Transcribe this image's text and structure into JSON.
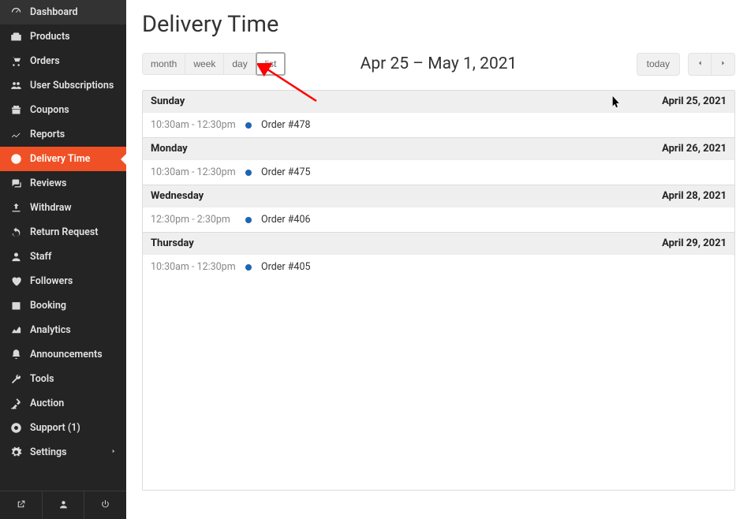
{
  "sidebar": {
    "items": [
      {
        "label": "Dashboard",
        "icon": "dashboard"
      },
      {
        "label": "Products",
        "icon": "briefcase"
      },
      {
        "label": "Orders",
        "icon": "cart"
      },
      {
        "label": "User Subscriptions",
        "icon": "users"
      },
      {
        "label": "Coupons",
        "icon": "gift"
      },
      {
        "label": "Reports",
        "icon": "chart"
      },
      {
        "label": "Delivery Time",
        "icon": "clock",
        "active": true
      },
      {
        "label": "Reviews",
        "icon": "comments"
      },
      {
        "label": "Withdraw",
        "icon": "upload"
      },
      {
        "label": "Return Request",
        "icon": "undo"
      },
      {
        "label": "Staff",
        "icon": "user"
      },
      {
        "label": "Followers",
        "icon": "heart"
      },
      {
        "label": "Booking",
        "icon": "calendar"
      },
      {
        "label": "Analytics",
        "icon": "area"
      },
      {
        "label": "Announcements",
        "icon": "bell"
      },
      {
        "label": "Tools",
        "icon": "wrench"
      },
      {
        "label": "Auction",
        "icon": "gavel"
      },
      {
        "label": "Support (1)",
        "icon": "life-ring"
      },
      {
        "label": "Settings",
        "icon": "cog",
        "expandable": true
      }
    ]
  },
  "pageTitle": "Delivery Time",
  "toolbar": {
    "viewButtons": [
      {
        "label": "month",
        "active": false
      },
      {
        "label": "week",
        "active": false
      },
      {
        "label": "day",
        "active": false
      },
      {
        "label": "list",
        "active": true
      }
    ],
    "dateRange": "Apr 25 – May 1, 2021",
    "today": "today"
  },
  "calendar": {
    "days": [
      {
        "name": "Sunday",
        "date": "April 25, 2021",
        "events": [
          {
            "time": "10:30am - 12:30pm",
            "title": "Order #478"
          }
        ]
      },
      {
        "name": "Monday",
        "date": "April 26, 2021",
        "events": [
          {
            "time": "10:30am - 12:30pm",
            "title": "Order #475"
          }
        ]
      },
      {
        "name": "Wednesday",
        "date": "April 28, 2021",
        "events": [
          {
            "time": "12:30pm - 2:30pm",
            "title": "Order #406"
          }
        ]
      },
      {
        "name": "Thursday",
        "date": "April 29, 2021",
        "events": [
          {
            "time": "10:30am - 12:30pm",
            "title": "Order #405"
          }
        ]
      }
    ]
  }
}
